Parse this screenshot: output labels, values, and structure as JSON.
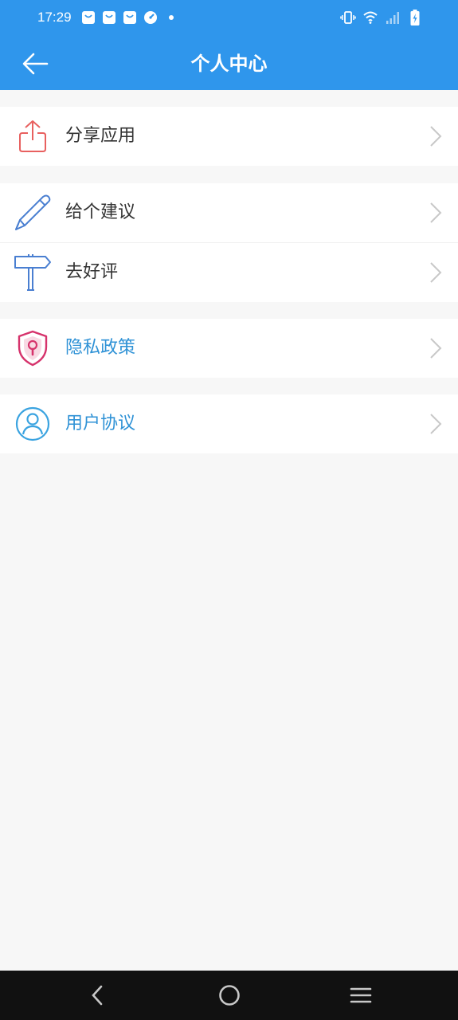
{
  "status_bar": {
    "time": "17:29",
    "left_icons": [
      "bag-notification-icon",
      "bag-notification-icon",
      "bag-notification-icon",
      "speedometer-icon",
      "dot-icon"
    ],
    "right_icons": [
      "vibrate-icon",
      "wifi-icon",
      "signal-icon",
      "battery-charging-icon"
    ]
  },
  "header": {
    "title": "个人中心",
    "back_icon": "arrow-left-icon",
    "color": "#2f96ec"
  },
  "menu": {
    "items": [
      {
        "label": "分享应用",
        "icon": "share-icon"
      },
      {
        "label": "给个建议",
        "icon": "pen-icon"
      },
      {
        "label": "去好评",
        "icon": "signpost-icon"
      },
      {
        "label": "隐私政策",
        "icon": "shield-lock-icon"
      },
      {
        "label": "用户协议",
        "icon": "user-circle-icon"
      }
    ]
  },
  "nav_bar": {
    "buttons": [
      "back-icon",
      "home-icon",
      "menu-icon"
    ]
  }
}
